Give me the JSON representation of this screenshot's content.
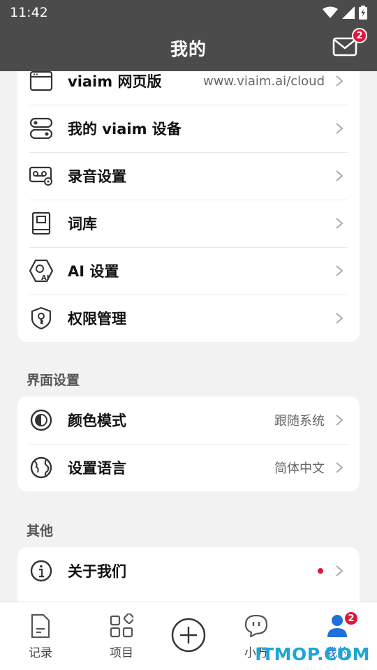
{
  "status_bar": {
    "time": "11:42"
  },
  "header": {
    "title": "我的",
    "mail_badge": "2"
  },
  "card1": {
    "items": [
      {
        "label": "viaim 网页版",
        "value": "www.viaim.ai/cloud"
      },
      {
        "label": "我的 viaim 设备",
        "value": ""
      },
      {
        "label": "录音设置",
        "value": ""
      },
      {
        "label": "词库",
        "value": ""
      },
      {
        "label": "AI 设置",
        "value": ""
      },
      {
        "label": "权限管理",
        "value": ""
      }
    ]
  },
  "section_ui": {
    "title": "界面设置",
    "items": [
      {
        "label": "颜色模式",
        "value": "跟随系统"
      },
      {
        "label": "设置语言",
        "value": "简体中文"
      }
    ]
  },
  "section_other": {
    "title": "其他",
    "items": [
      {
        "label": "关于我们",
        "value": ""
      }
    ]
  },
  "tabbar": {
    "tabs": [
      {
        "label": "记录"
      },
      {
        "label": "项目"
      },
      {
        "label": "小万"
      },
      {
        "label": "我的",
        "badge": "2"
      }
    ]
  },
  "watermark": "ITMOP.COM",
  "colors": {
    "header_bg": "#4b4b4b",
    "badge": "#e0173a",
    "active_tab": "#1e6fd9",
    "watermark": "#1ba6d6"
  }
}
